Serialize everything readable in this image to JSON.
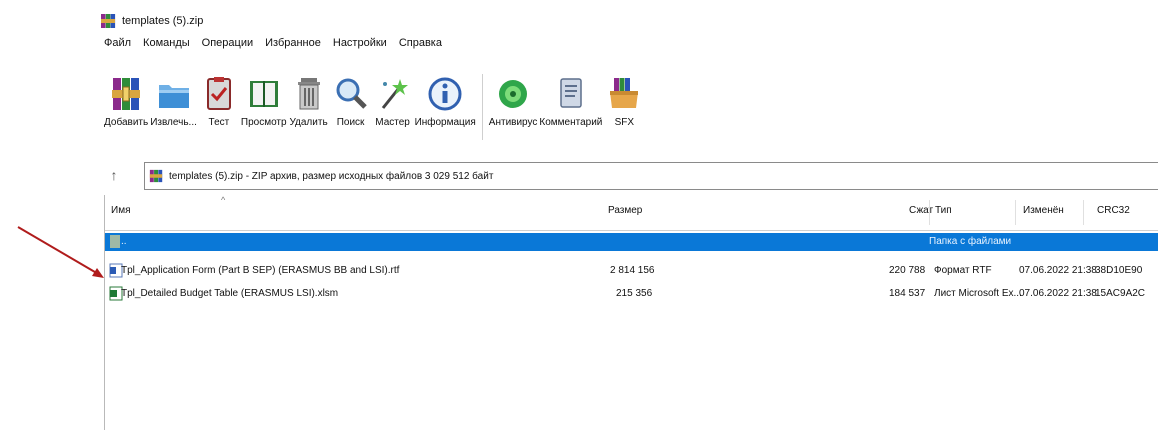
{
  "window": {
    "title": "templates (5).zip"
  },
  "menu": [
    "Файл",
    "Команды",
    "Операции",
    "Избранное",
    "Настройки",
    "Справка"
  ],
  "toolbar": [
    {
      "label": "Добавить",
      "icon": "add-archive-icon"
    },
    {
      "label": "Извлечь...",
      "icon": "extract-folder-icon"
    },
    {
      "label": "Тест",
      "icon": "test-clipboard-icon"
    },
    {
      "label": "Просмотр",
      "icon": "view-book-icon"
    },
    {
      "label": "Удалить",
      "icon": "delete-trash-icon"
    },
    {
      "label": "Поиск",
      "icon": "find-magnifier-icon"
    },
    {
      "label": "Мастер",
      "icon": "wizard-wand-icon"
    },
    {
      "label": "Информация",
      "icon": "info-icon"
    },
    {
      "label": "Антивирус",
      "icon": "antivirus-icon"
    },
    {
      "label": "Комментарий",
      "icon": "comment-icon"
    },
    {
      "label": "SFX",
      "icon": "sfx-box-icon"
    }
  ],
  "address": {
    "text": "templates (5).zip - ZIP архив, размер исходных файлов 3 029 512 байт"
  },
  "columns": {
    "name": "Имя",
    "size": "Размер",
    "packed": "Сжат",
    "type": "Тип",
    "modified": "Изменён",
    "crc": "CRC32"
  },
  "rows": [
    {
      "name": "..",
      "size": "",
      "packed": "",
      "type": "Папка с файлами",
      "modified": "",
      "crc": "",
      "selected": true,
      "icon": "parent-folder-icon"
    },
    {
      "name": "Tpl_Application Form (Part B SEP) (ERASMUS BB and LSI).rtf",
      "size": "2 814 156",
      "packed": "220 788",
      "type": "Формат RTF",
      "modified": "07.06.2022 21:38",
      "crc": "38D10E90",
      "selected": false,
      "icon": "rtf-file-icon"
    },
    {
      "name": "Tpl_Detailed Budget Table (ERASMUS LSI).xlsm",
      "size": "215 356",
      "packed": "184 537",
      "type": "Лист Microsoft Ex...",
      "modified": "07.06.2022 21:38",
      "crc": "15AC9A2C",
      "selected": false,
      "icon": "excel-file-icon"
    }
  ],
  "colors": {
    "selection": "#0a78d7",
    "arrow": "#b01c1c"
  }
}
